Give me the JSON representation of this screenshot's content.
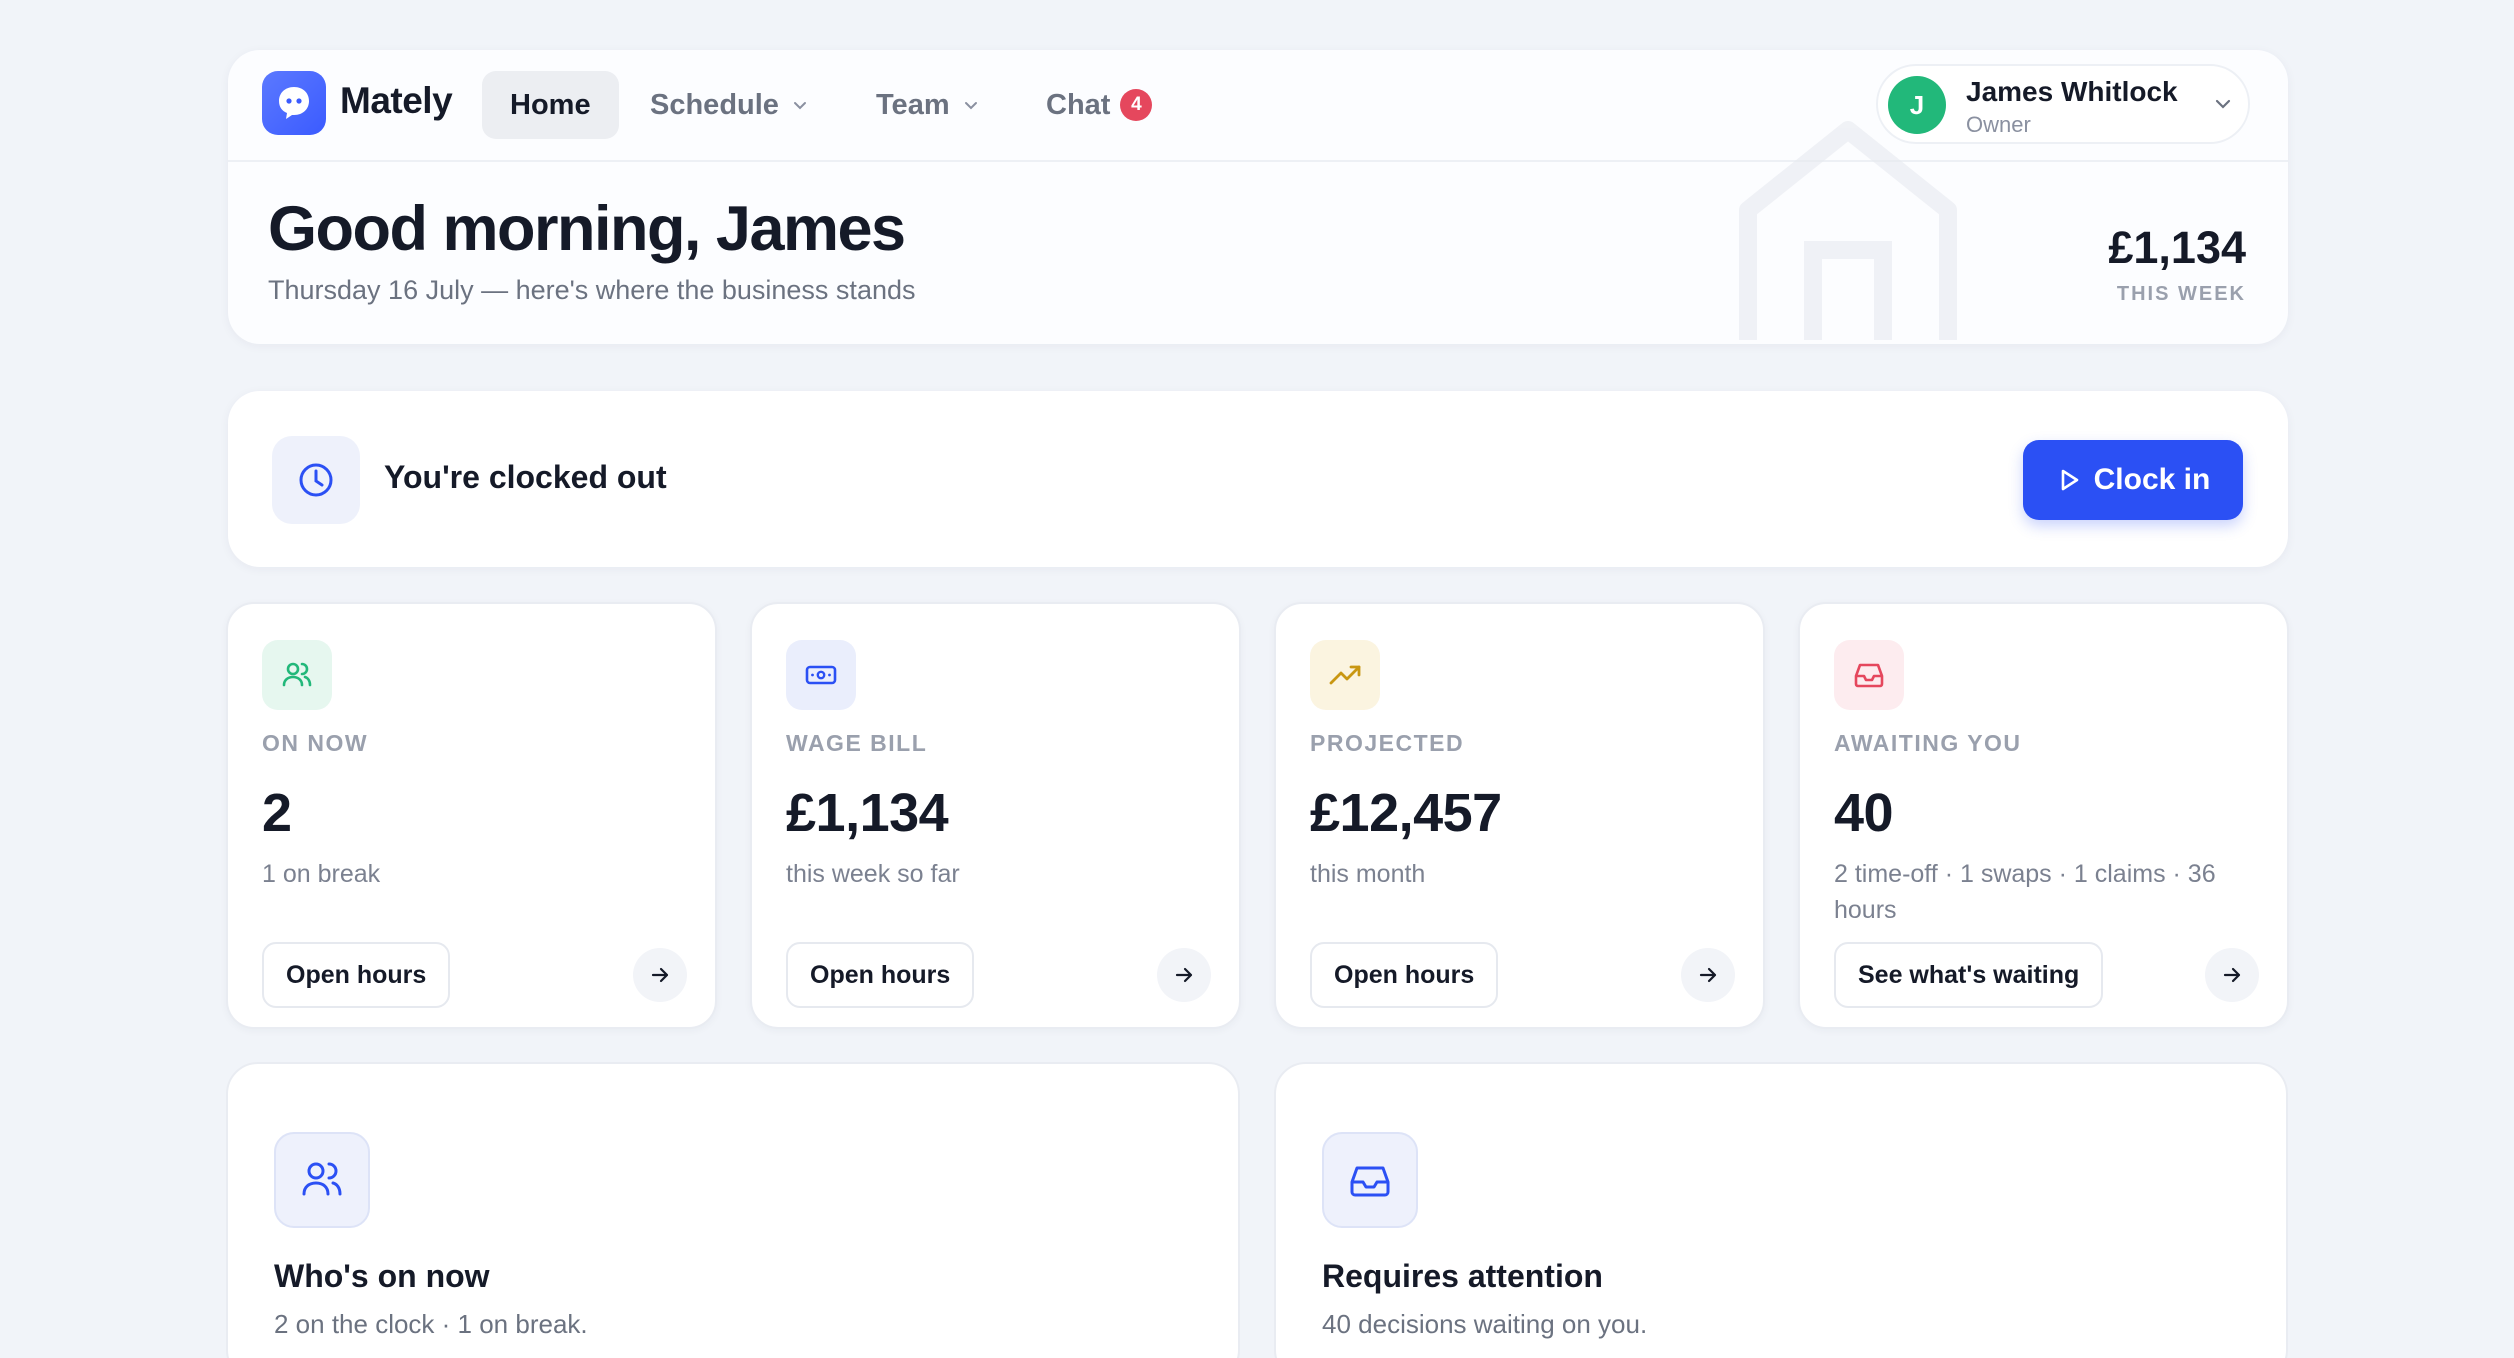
{
  "app": {
    "brand": "Mately"
  },
  "nav": {
    "items": [
      {
        "label": "Home",
        "active": true
      },
      {
        "label": "Schedule",
        "dropdown": true
      },
      {
        "label": "Team",
        "dropdown": true
      },
      {
        "label": "Chat",
        "badge": "4"
      }
    ]
  },
  "user": {
    "initial": "J",
    "name": "James Whitlock",
    "role": "Owner"
  },
  "header": {
    "greeting": "Good morning, James",
    "subline": "Thursday 16 July — here's where the business stands",
    "week_amount": "£1,134",
    "week_label": "THIS WEEK"
  },
  "clock": {
    "status": "You're clocked out",
    "button_label": "Clock in"
  },
  "stats": [
    {
      "label": "ON NOW",
      "value": "2",
      "sub": "1 on break",
      "button": "Open hours",
      "icon": "users-icon",
      "color": "#22b87a"
    },
    {
      "label": "WAGE BILL",
      "value": "£1,134",
      "sub": "this week so far",
      "button": "Open hours",
      "icon": "cash-icon",
      "color": "#2b50f4"
    },
    {
      "label": "PROJECTED",
      "value": "£12,457",
      "sub": "this month",
      "button": "Open hours",
      "icon": "trending-up-icon",
      "color": "#c99712"
    },
    {
      "label": "AWAITING YOU",
      "value": "40",
      "sub": "2 time-off · 1 swaps · 1 claims · 36 hours",
      "button": "See what's waiting",
      "icon": "inbox-icon",
      "color": "#e5475d"
    }
  ],
  "panels": [
    {
      "title": "Who's on now",
      "sub": "2 on the clock · 1 on break.",
      "icon": "users-icon"
    },
    {
      "title": "Requires attention",
      "sub": "40 decisions waiting on you.",
      "icon": "inbox-icon"
    }
  ],
  "colors": {
    "accent": "#2b50f4",
    "success": "#22b87a",
    "danger": "#e5475d",
    "warning": "#c99712"
  }
}
